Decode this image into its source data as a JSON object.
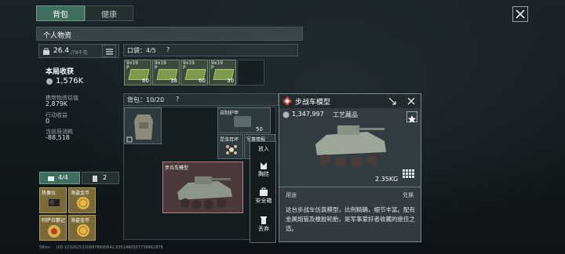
{
  "tabs": {
    "backpack": "背包",
    "health": "健康"
  },
  "section_title": "个人物资",
  "weight": {
    "current": "26.4",
    "max": "/78千克"
  },
  "income": {
    "title": "本局收获",
    "value": "1,576K"
  },
  "stats": [
    {
      "label": "携带物资估值",
      "value": "2,879K"
    },
    {
      "label": "行动收益",
      "value": "0"
    },
    {
      "label": "当前局消耗",
      "value": "-88,518"
    }
  ],
  "pockets": {
    "label": "口袋：4/5",
    "help": "?"
  },
  "ammo": [
    {
      "caption": "9x19\nP",
      "count": "60"
    },
    {
      "caption": "9x19\nP",
      "count": "38"
    },
    {
      "caption": "9x19\nP",
      "count": "60"
    },
    {
      "caption": "9x19\nP",
      "count": "30"
    }
  ],
  "backpack": {
    "label": "背包：10/20",
    "help": "?"
  },
  "backpack_items": {
    "vest_label": "自制护甲",
    "vest_value": "50",
    "shield_label": "",
    "charm_label": "昆虫耳坏",
    "military_label": "军事情报"
  },
  "vehicle_slot": {
    "label": "步兵车模型"
  },
  "context_menu": {
    "place": "放入",
    "chest": "胸挂",
    "safe": "安全箱",
    "discard": "丢弃"
  },
  "equip_tabs": {
    "a": "4/4",
    "b": "2"
  },
  "equip_items": [
    {
      "label": "热像仪"
    },
    {
      "label": "海盗金币"
    },
    {
      "label": "阿萨拉徽记"
    },
    {
      "label": "海盗金币"
    }
  ],
  "detail": {
    "title": "步战车模型",
    "price": "1,347,997",
    "category": "工艺藏品",
    "weight": "2.35KG",
    "usage": "用途",
    "exchange": "兑换",
    "description": "这台步战车仿真模型，比例精确，细节丰富。配有金属炮管及橡胶轮胎，是军事爱好者收藏的绝佳之选。"
  },
  "status_bar": {
    "ping": "58ms",
    "id": "UID:10326253309978895642,63514805577384628T8"
  },
  "colors": {
    "accent": "#3f6e5e",
    "highlight": "#d94040",
    "panel": "#283438"
  }
}
